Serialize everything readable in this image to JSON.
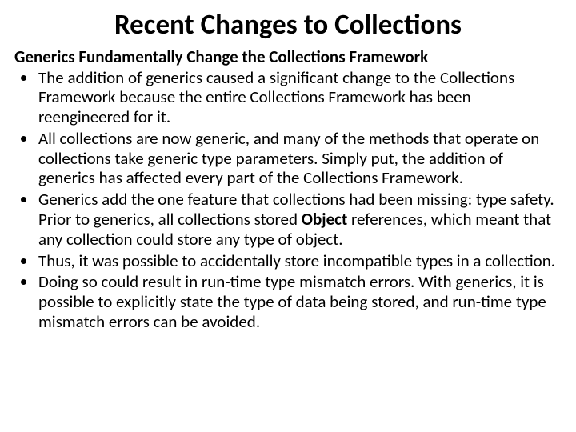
{
  "title": "Recent Changes to Collections",
  "subhead": "Generics Fundamentally Change the Collections Framework",
  "bullets": [
    {
      "pre": "The addition of generics caused a significant change to the Collections Framework because the entire Collections Framework has been reengineered for it.",
      "bold": "",
      "post": ""
    },
    {
      "pre": "All collections are now generic, and many of the methods that operate on collections take generic type parameters. Simply put, the addition of generics has affected every part of the Collections Framework.",
      "bold": "",
      "post": ""
    },
    {
      "pre": "Generics add the one feature that collections had been missing: type safety. Prior to generics, all collections stored ",
      "bold": "Object",
      "post": " references, which meant that any collection could store any type of object."
    },
    {
      "pre": "Thus, it was possible to accidentally store incompatible types in a collection.",
      "bold": "",
      "post": ""
    },
    {
      "pre": "Doing so could result in run-time type mismatch errors. With generics, it is possible to explicitly state the type of data being stored, and run-time type mismatch errors can be avoided.",
      "bold": "",
      "post": ""
    }
  ]
}
